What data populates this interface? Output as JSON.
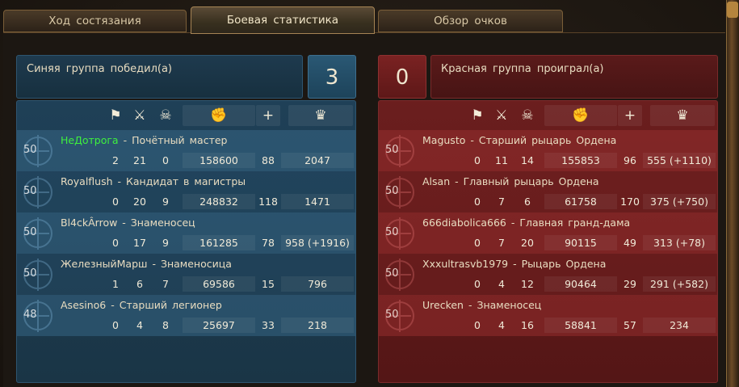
{
  "tabs": [
    {
      "label": "Ход состязания",
      "active": false
    },
    {
      "label": "Боевая статистика",
      "active": true
    },
    {
      "label": "Обзор очков",
      "active": false
    }
  ],
  "blue": {
    "status": "Синяя группа победил(а)",
    "score": "3",
    "accent": "#1f4057",
    "players": [
      {
        "level": "50",
        "name": "НеДотрога",
        "title": "Почётный мастер",
        "highlight": true,
        "stats": [
          "2",
          "21",
          "0",
          "158600",
          "88",
          "2047"
        ]
      },
      {
        "level": "50",
        "name": "Royalflush",
        "title": "Кандидат в магистры",
        "highlight": false,
        "stats": [
          "0",
          "20",
          "9",
          "248832",
          "118",
          "1471"
        ]
      },
      {
        "level": "50",
        "name": "Bl4ckÂrrow",
        "title": "Знаменосец",
        "highlight": false,
        "stats": [
          "0",
          "17",
          "9",
          "161285",
          "78",
          "958 (+1916)"
        ]
      },
      {
        "level": "50",
        "name": "ЖелезныйМарш",
        "title": "Знаменосица",
        "highlight": false,
        "stats": [
          "1",
          "6",
          "7",
          "69586",
          "15",
          "796"
        ]
      },
      {
        "level": "48",
        "name": "Asesino6",
        "title": "Старший легионер",
        "highlight": false,
        "stats": [
          "0",
          "4",
          "8",
          "25697",
          "33",
          "218"
        ]
      }
    ]
  },
  "red": {
    "status": "Красная группа проиграл(а)",
    "score": "0",
    "accent": "#6b1e1e",
    "players": [
      {
        "level": "50",
        "name": "Magusto",
        "title": "Старший рыцарь Ордена",
        "highlight": false,
        "stats": [
          "0",
          "11",
          "14",
          "155853",
          "96",
          "555 (+1110)"
        ]
      },
      {
        "level": "50",
        "name": "Alsan",
        "title": "Главный рыцарь Ордена",
        "highlight": false,
        "stats": [
          "0",
          "7",
          "6",
          "61758",
          "170",
          "375 (+750)"
        ]
      },
      {
        "level": "50",
        "name": "666diabolica666",
        "title": "Главная гранд-дама",
        "highlight": false,
        "stats": [
          "0",
          "7",
          "20",
          "90115",
          "49",
          "313 (+78)"
        ]
      },
      {
        "level": "50",
        "name": "Xxxultrasvb1979",
        "title": "Рыцарь Ордена",
        "highlight": false,
        "stats": [
          "0",
          "4",
          "12",
          "90464",
          "29",
          "291 (+582)"
        ]
      },
      {
        "level": "50",
        "name": "Urecken",
        "title": "Знаменосец",
        "highlight": false,
        "stats": [
          "0",
          "4",
          "16",
          "58841",
          "57",
          "234"
        ]
      }
    ]
  },
  "columns": [
    {
      "icon": "flag-icon",
      "glyph": "⚑"
    },
    {
      "icon": "crossed-swords-icon",
      "glyph": "⚔"
    },
    {
      "icon": "skull-icon",
      "glyph": "☠"
    },
    {
      "icon": "fist-icon",
      "glyph": "✊"
    },
    {
      "icon": "plus-icon",
      "glyph": "+"
    },
    {
      "icon": "crown-icon",
      "glyph": "♛"
    }
  ],
  "separator": "-"
}
